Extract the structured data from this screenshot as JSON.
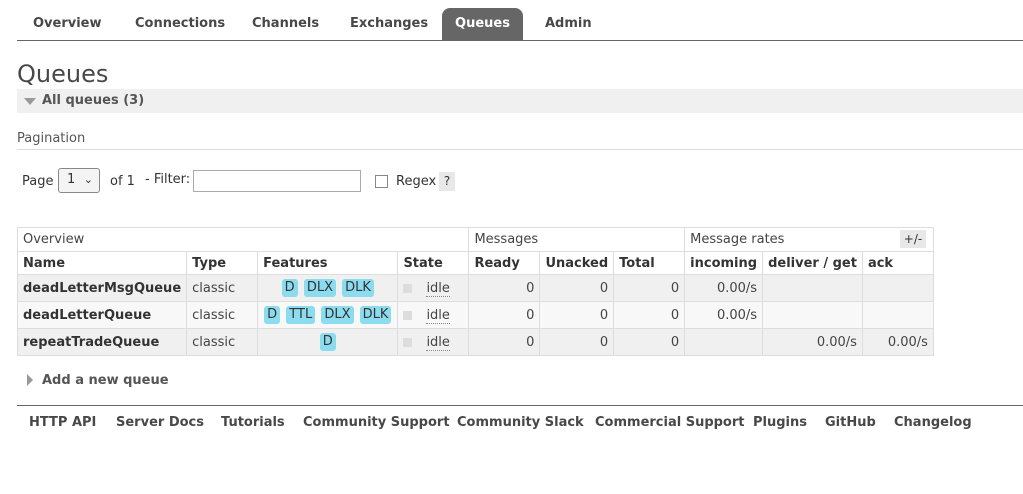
{
  "nav": {
    "tabs": [
      {
        "label": "Overview"
      },
      {
        "label": "Connections"
      },
      {
        "label": "Channels"
      },
      {
        "label": "Exchanges"
      },
      {
        "label": "Queues"
      },
      {
        "label": "Admin"
      }
    ],
    "active": "Queues"
  },
  "page_title": "Queues",
  "section": {
    "title": "All queues (3)"
  },
  "pagination": {
    "label": "Pagination",
    "page_label": "Page",
    "page_value": "1",
    "of_label": "of 1",
    "filter_label": "- Filter:",
    "filter_value": "",
    "regex_label": "Regex",
    "help": "?"
  },
  "table": {
    "groups": [
      "Overview",
      "Messages",
      "Message rates"
    ],
    "columns": [
      "Name",
      "Type",
      "Features",
      "State",
      "Ready",
      "Unacked",
      "Total",
      "incoming",
      "deliver / get",
      "ack"
    ],
    "toggle": "+/-",
    "rows": [
      {
        "name": "deadLetterMsgQueue",
        "type": "classic",
        "features": [
          "D",
          "DLX",
          "DLK"
        ],
        "state": "idle",
        "ready": "0",
        "unacked": "0",
        "total": "0",
        "incoming": "0.00/s",
        "deliver_get": "",
        "ack": ""
      },
      {
        "name": "deadLetterQueue",
        "type": "classic",
        "features": [
          "D",
          "TTL",
          "DLX",
          "DLK"
        ],
        "state": "idle",
        "ready": "0",
        "unacked": "0",
        "total": "0",
        "incoming": "0.00/s",
        "deliver_get": "",
        "ack": ""
      },
      {
        "name": "repeatTradeQueue",
        "type": "classic",
        "features": [
          "D"
        ],
        "state": "idle",
        "ready": "0",
        "unacked": "0",
        "total": "0",
        "incoming": "",
        "deliver_get": "0.00/s",
        "ack": "0.00/s"
      }
    ]
  },
  "add_queue": {
    "label": "Add a new queue"
  },
  "footer": {
    "links": [
      "HTTP API",
      "Server Docs",
      "Tutorials",
      "Community Support",
      "Community Slack",
      "Commercial Support",
      "Plugins",
      "GitHub",
      "Changelog"
    ]
  },
  "colors": {
    "accent": "#666666",
    "badge": "#8cdcf0"
  }
}
